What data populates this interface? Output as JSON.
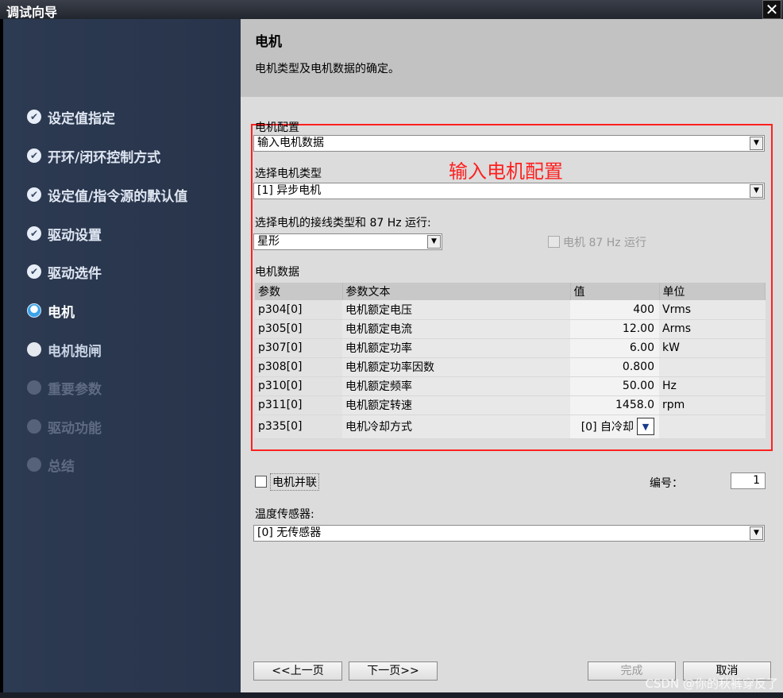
{
  "window": {
    "title": "调试向导",
    "close_glyph": "✕"
  },
  "sidebar": {
    "items": [
      {
        "label": "设定值指定",
        "state": "done",
        "icon": "check-icon"
      },
      {
        "label": "开环/闭环控制方式",
        "state": "done",
        "icon": "check-icon"
      },
      {
        "label": "设定值/指令源的默认值",
        "state": "done",
        "icon": "check-icon"
      },
      {
        "label": "驱动设置",
        "state": "done",
        "icon": "check-icon"
      },
      {
        "label": "驱动选件",
        "state": "done",
        "icon": "check-icon"
      },
      {
        "label": "电机",
        "state": "active",
        "icon": "current-step-icon"
      },
      {
        "label": "电机抱闸",
        "state": "pending",
        "icon": "pending-step-icon"
      },
      {
        "label": "重要参数",
        "state": "disabled",
        "icon": "pending-step-icon"
      },
      {
        "label": "驱动功能",
        "state": "disabled",
        "icon": "pending-step-icon"
      },
      {
        "label": "总结",
        "state": "disabled",
        "icon": "pending-step-icon"
      }
    ]
  },
  "header": {
    "title": "电机",
    "description": "电机类型及电机数据的确定。"
  },
  "motor_config": {
    "label": "电机配置",
    "value": "输入电机数据",
    "annotation": "输入电机配置"
  },
  "motor_type": {
    "label": "选择电机类型",
    "value": "[1] 异步电机"
  },
  "wiring": {
    "label": "选择电机的接线类型和 87 Hz 运行:",
    "value": "星形",
    "option_87hz_label": "电机 87 Hz 运行"
  },
  "motor_data": {
    "label": "电机数据",
    "columns": [
      "参数",
      "参数文本",
      "值",
      "单位"
    ],
    "rows": [
      {
        "param": "p304[0]",
        "text": "电机额定电压",
        "value": "400",
        "unit": "Vrms"
      },
      {
        "param": "p305[0]",
        "text": "电机额定电流",
        "value": "12.00",
        "unit": "Arms"
      },
      {
        "param": "p307[0]",
        "text": "电机额定功率",
        "value": "6.00",
        "unit": "kW"
      },
      {
        "param": "p308[0]",
        "text": "电机额定功率因数",
        "value": "0.800",
        "unit": ""
      },
      {
        "param": "p310[0]",
        "text": "电机额定频率",
        "value": "50.00",
        "unit": "Hz"
      },
      {
        "param": "p311[0]",
        "text": "电机额定转速",
        "value": "1458.0",
        "unit": "rpm"
      },
      {
        "param": "p335[0]",
        "text": "电机冷却方式",
        "value": "[0] 自冷却",
        "unit": ""
      }
    ]
  },
  "parallel": {
    "label": "电机并联",
    "number_label": "编号：",
    "number_value": "1"
  },
  "temp_sensor": {
    "label": "温度传感器:",
    "value": "[0] 无传感器"
  },
  "footer": {
    "prev_label": "<<上一页",
    "next_label": "下一页>>",
    "finish_label": "完成",
    "cancel_label": "取消",
    "watermark": "CSDN @你的秋裤穿反了"
  }
}
